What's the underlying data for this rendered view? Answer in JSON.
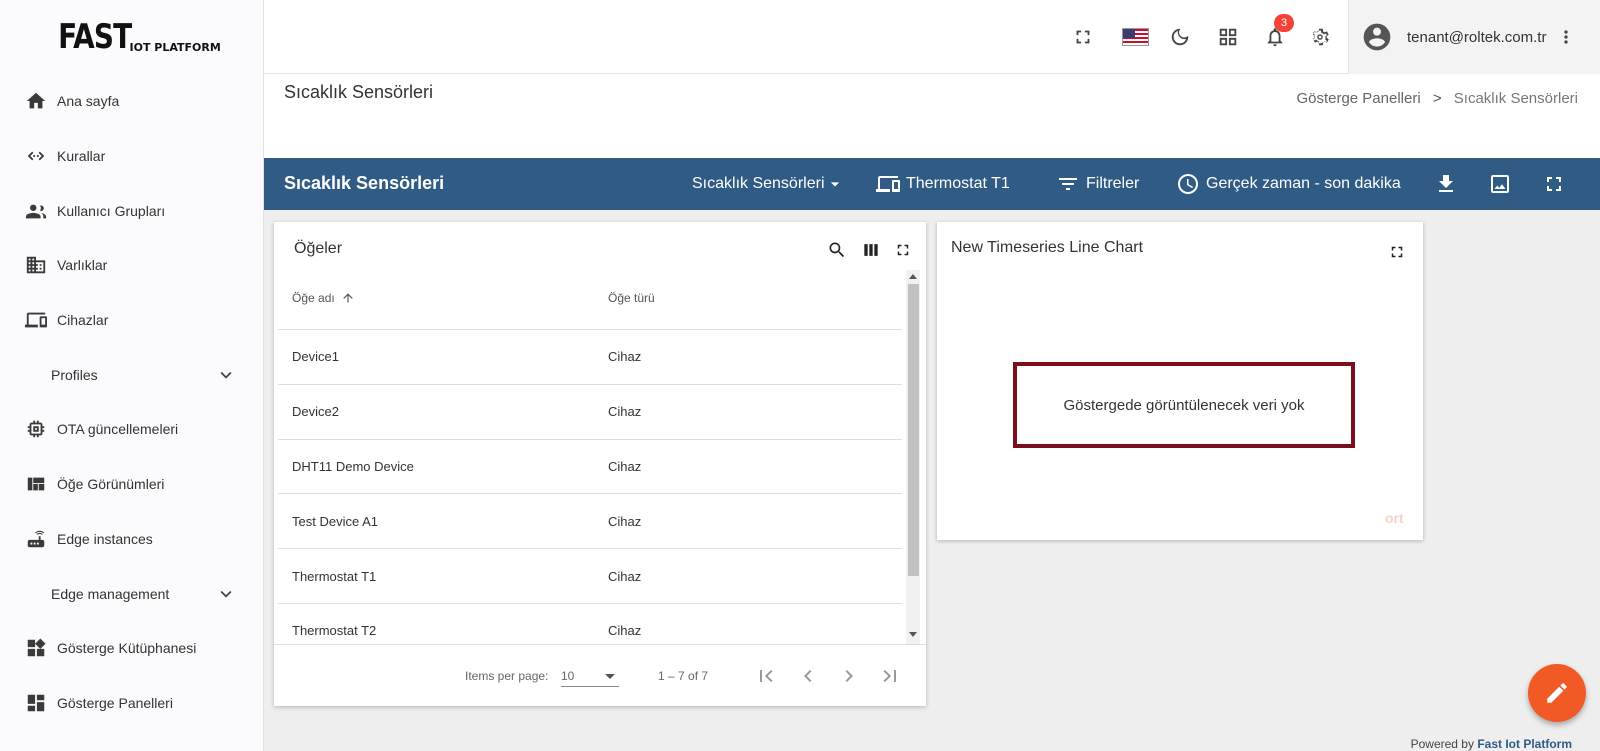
{
  "logo": {
    "big": "FAST",
    "small": "IOT PLATFORM"
  },
  "sidebar": {
    "items": [
      {
        "label": "Ana sayfa",
        "icon": "home-icon"
      },
      {
        "label": "Kurallar",
        "icon": "rule-chain-icon"
      },
      {
        "label": "Kullanıcı Grupları",
        "icon": "user-groups-icon"
      },
      {
        "label": "Varlıklar",
        "icon": "building-icon"
      },
      {
        "label": "Cihazlar",
        "icon": "devices-icon"
      },
      {
        "label": "Profiles",
        "icon": "chevron-down-icon",
        "group": true
      },
      {
        "label": "OTA güncellemeleri",
        "icon": "chip-icon"
      },
      {
        "label": "Öğe Görünümleri",
        "icon": "view-quilt-icon"
      },
      {
        "label": "Edge instances",
        "icon": "router-icon"
      },
      {
        "label": "Edge management",
        "icon": "chevron-down-icon",
        "group": true
      },
      {
        "label": "Gösterge Kütüphanesi",
        "icon": "widgets-icon"
      },
      {
        "label": "Gösterge Panelleri",
        "icon": "dashboard-icon"
      }
    ]
  },
  "topbar": {
    "notification_count": "3",
    "user_email": "tenant@roltek.com.tr",
    "icons": [
      "fullscreen-icon",
      "us-flag-icon",
      "dark-mode-icon",
      "apps-grid-icon",
      "bell-icon",
      "settings-icon",
      "avatar-icon",
      "more-vert-icon"
    ]
  },
  "page": {
    "title": "Sıcaklık Sensörleri",
    "breadcrumb": {
      "parent": "Gösterge Panelleri",
      "separator": ">",
      "current": "Sıcaklık Sensörleri"
    }
  },
  "dashboard_bar": {
    "title": "Sıcaklık Sensörleri",
    "state_select": "Sıcaklık Sensörleri",
    "entity_alias": "Thermostat T1",
    "filters": "Filtreler",
    "timewindow": "Gerçek zaman - son dakika",
    "color": "#2f5b85"
  },
  "table_widget": {
    "title": "Öğeler",
    "columns": [
      "Öğe adı",
      "Öğe türü"
    ],
    "rows": [
      {
        "name": "Device1",
        "type": "Cihaz"
      },
      {
        "name": "Device2",
        "type": "Cihaz"
      },
      {
        "name": "DHT11 Demo Device",
        "type": "Cihaz"
      },
      {
        "name": "Test Device A1",
        "type": "Cihaz"
      },
      {
        "name": "Thermostat T1",
        "type": "Cihaz"
      },
      {
        "name": "Thermostat T2",
        "type": "Cihaz"
      },
      {
        "name": "",
        "type": ""
      }
    ],
    "paginator": {
      "items_per_page_label": "Items per page:",
      "page_size": "10",
      "range_label": "1 – 7 of 7"
    }
  },
  "chart_widget": {
    "title": "New Timeseries Line Chart",
    "no_data_text": "Göstergede görüntülenecek veri yok",
    "faint_text": "ort",
    "highlight_color": "#7b0f1e"
  },
  "footer": {
    "powered_prefix": "Powered by",
    "powered_brand": "Fast Iot Platform"
  },
  "fab_color": "#f15a24"
}
